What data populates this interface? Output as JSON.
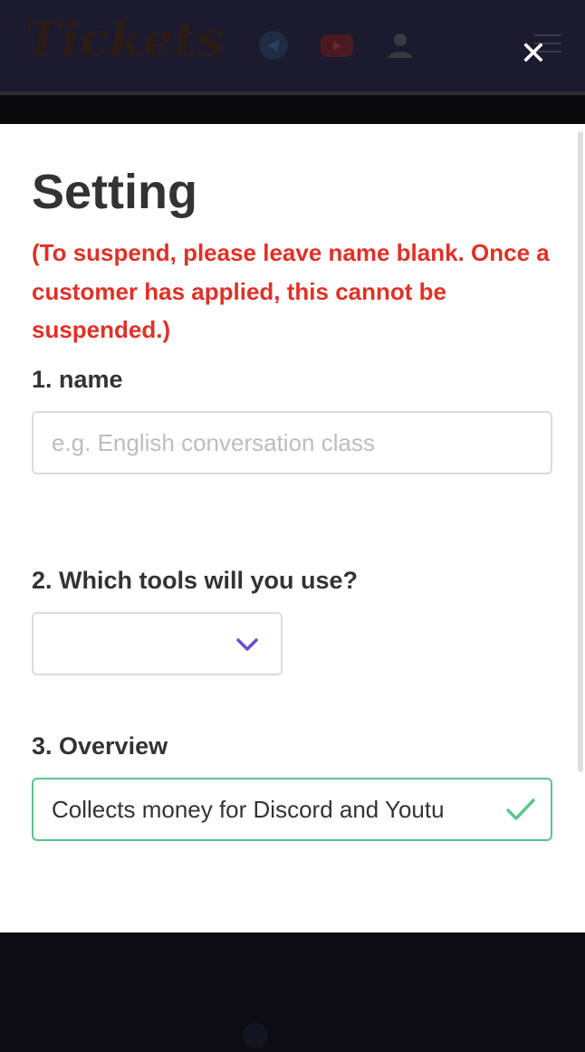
{
  "header": {
    "logo_text": "Tickets",
    "icons": [
      "telegram-icon",
      "youtube-icon",
      "user-icon",
      "hamburger-menu-icon"
    ],
    "close_icon": "close-icon",
    "close_symbol": "✕"
  },
  "modal": {
    "title": "Setting",
    "warning": "(To suspend, please leave name blank. Once a customer has applied, this cannot be suspended.)",
    "fields": {
      "name": {
        "label": "1. name",
        "value": "",
        "placeholder": "e.g. English conversation class"
      },
      "tools": {
        "label": "2. Which tools will you use?",
        "selected": "",
        "icon": "chevron-down-icon"
      },
      "overview": {
        "label": "3. Overview",
        "value": "Collects money for Discord and Youtu",
        "status": "valid",
        "icon": "check-icon"
      }
    }
  },
  "colors": {
    "warning": "#e03127",
    "valid_border": "#5cc48c",
    "chevron": "#6a4fc7",
    "header_bg": "#1b1a2e"
  }
}
